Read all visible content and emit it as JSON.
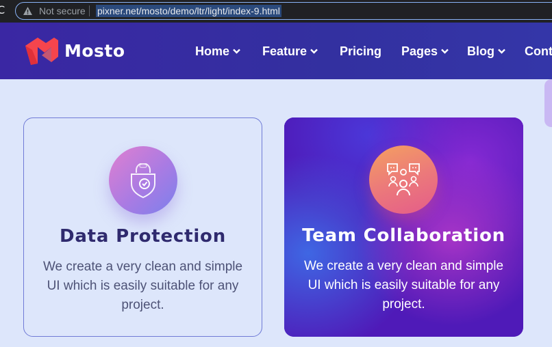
{
  "browser": {
    "security_label": "Not secure",
    "url": "pixner.net/mosto/demo/ltr/light/index-9.html"
  },
  "header": {
    "brand": "Mosto",
    "nav": [
      {
        "label": "Home",
        "has_dropdown": true
      },
      {
        "label": "Feature",
        "has_dropdown": true
      },
      {
        "label": "Pricing",
        "has_dropdown": false
      },
      {
        "label": "Pages",
        "has_dropdown": true
      },
      {
        "label": "Blog",
        "has_dropdown": true
      },
      {
        "label": "Cont",
        "has_dropdown": false
      }
    ]
  },
  "cards": [
    {
      "icon": "shield-lock-icon",
      "title": "Data Protection",
      "text_lines": [
        "We create a very clean and simple",
        "UI which is easily suitable for any",
        "project."
      ]
    },
    {
      "icon": "team-chat-icon",
      "title": "Team Collaboration",
      "text_lines": [
        "We create a very clean and simple",
        "UI which is easily suitable for any",
        "project."
      ]
    }
  ],
  "colors": {
    "header_bg": "#3a27a3",
    "page_bg": "#dde6fb",
    "card_highlight_bg": "#5b1cc4",
    "logo_red": "#f5454d"
  }
}
